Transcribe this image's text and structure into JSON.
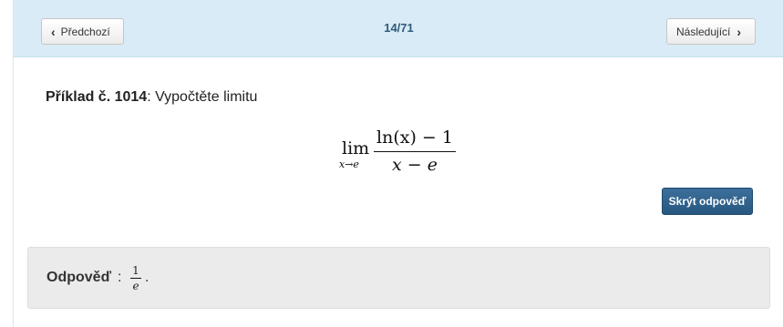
{
  "nav": {
    "prev_label": "Předchozí",
    "prev_icon": "chevron-left-icon",
    "next_label": "Následující",
    "next_icon": "chevron-right-icon",
    "counter": "14/71"
  },
  "exercise": {
    "label": "Příklad č. 1014",
    "prompt": ": Vypočtěte limitu",
    "formula": {
      "operator": "lim",
      "subscript": "x→e",
      "numerator": "ln(x) − 1",
      "denominator": "x − e"
    },
    "hide_answer_label": "Skrýt odpověď"
  },
  "answer": {
    "label": "Odpověď",
    "colon": ":",
    "numerator": "1",
    "denominator": "e",
    "trailing": "."
  },
  "colors": {
    "topbar": "#d9ebf6",
    "counter": "#2f5b7c",
    "primary_button": "#285880",
    "answer_bg": "#ebebeb"
  }
}
